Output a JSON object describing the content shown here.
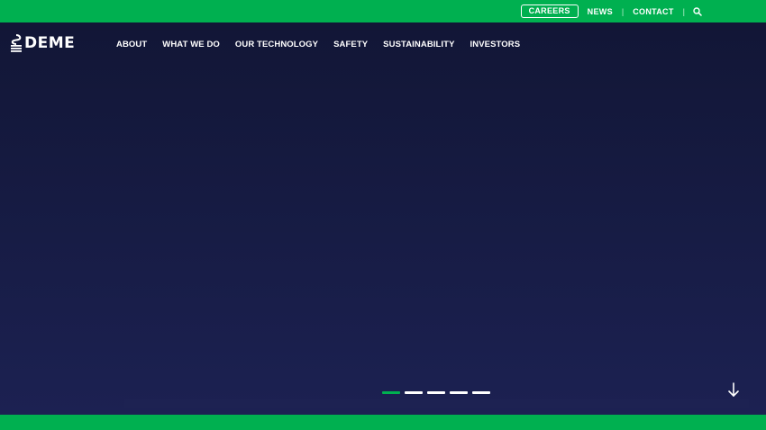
{
  "topbar": {
    "careers_label": "CAREERS",
    "news_label": "NEWS",
    "contact_label": "CONTACT",
    "separator": "|",
    "search_icon": "search-icon"
  },
  "header": {
    "logo_text": "DEME",
    "nav_items": [
      {
        "label": "ABOUT"
      },
      {
        "label": "WHAT WE DO"
      },
      {
        "label": "OUR TECHNOLOGY"
      },
      {
        "label": "SAFETY"
      },
      {
        "label": "SUSTAINABILITY"
      },
      {
        "label": "INVESTORS"
      }
    ]
  },
  "hero": {
    "slides_count": 5,
    "active_slide": 1,
    "scroll_icon": "arrow-down-icon"
  },
  "colors": {
    "accent": "#00b050",
    "background": "#14183a",
    "text": "#ffffff"
  }
}
